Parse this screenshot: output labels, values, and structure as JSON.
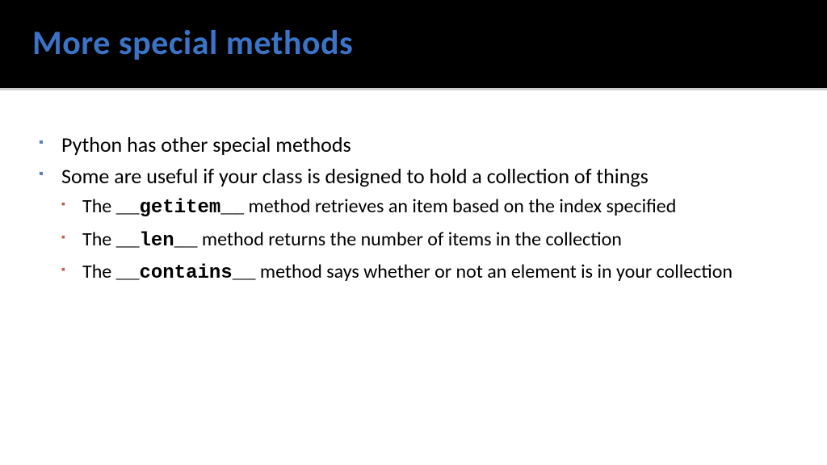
{
  "title": "More special methods",
  "bullets": {
    "b1": "Python has other special methods",
    "b2": "Some are useful if your class is designed to hold a collection of things",
    "s1_pre": "The ",
    "s1_code": "__getitem__",
    "s1_post": " method retrieves an item based on the index specified",
    "s2_pre": "The ",
    "s2_code": "__len__",
    "s2_post": " method returns the number of items in the collection",
    "s3_pre": "The ",
    "s3_code": "__contains__",
    "s3_post": " method says whether or not an element is in your collection"
  }
}
